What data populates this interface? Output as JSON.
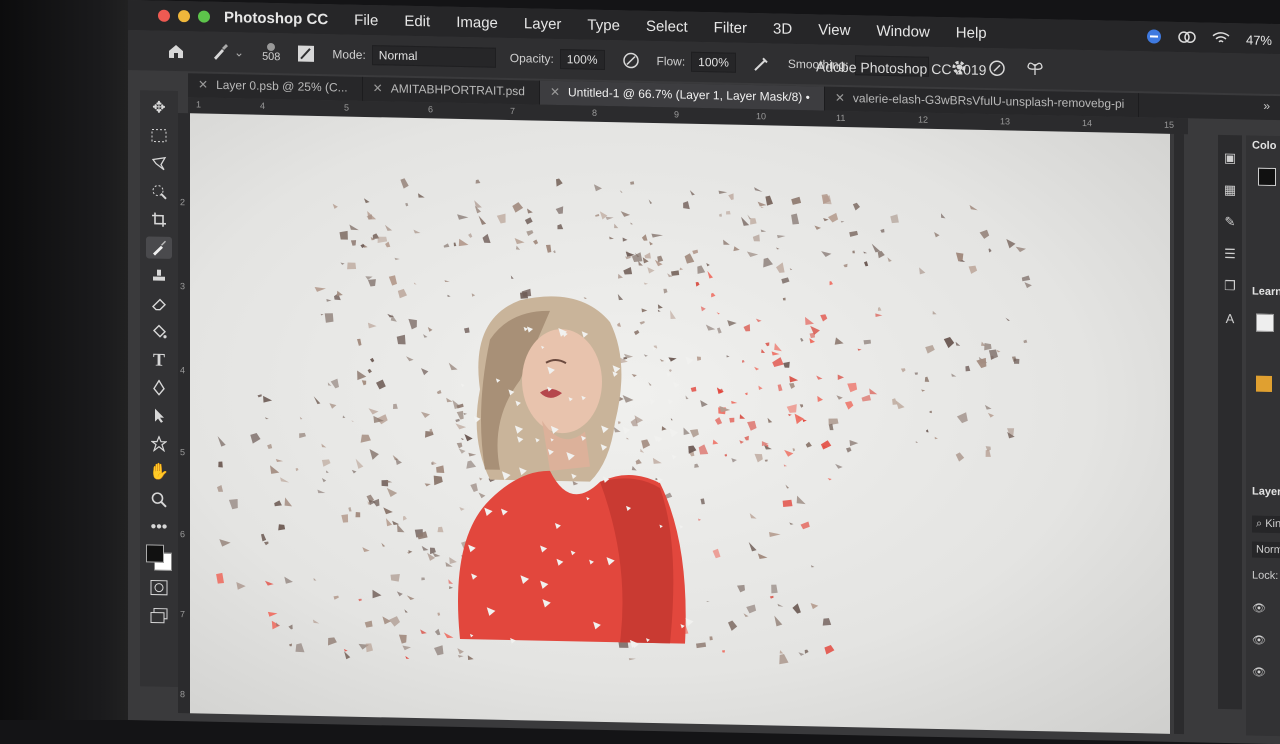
{
  "menubar": {
    "app_name": "Photoshop CC",
    "items": [
      "File",
      "Edit",
      "Image",
      "Layer",
      "Type",
      "Select",
      "Filter",
      "3D",
      "View",
      "Window",
      "Help"
    ],
    "battery": "47%"
  },
  "options": {
    "brush_size": "508",
    "mode_label": "Mode:",
    "mode_value": "Normal",
    "opacity_label": "Opacity:",
    "opacity_value": "100%",
    "flow_label": "Flow:",
    "flow_value": "100%",
    "smoothing_label": "Smoothing:",
    "app_title": "Adobe Photoshop CC 2019"
  },
  "tabs": [
    {
      "label": "Layer 0.psb @ 25% (C..."
    },
    {
      "label": "AMITABHPORTRAIT.psd"
    },
    {
      "label": "Untitled-1 @ 66.7% (Layer 1, Layer Mask/8) •"
    },
    {
      "label": "valerie-elash-G3wBRsVfulU-unsplash-removebg-pi"
    }
  ],
  "tabs_overflow": "»",
  "ruler": {
    "top": [
      "1",
      "4",
      "5",
      "6",
      "7",
      "8",
      "9",
      "10",
      "11",
      "12",
      "13",
      "14",
      "15"
    ],
    "left": [
      "2",
      "3",
      "4",
      "5",
      "6",
      "7",
      "8"
    ]
  },
  "panels": {
    "color": "Colo",
    "learn": "Learn",
    "layers": "Layers",
    "kind": "Kind",
    "blend": "Normal",
    "lock": "Lock:"
  },
  "colors": {
    "accent_red": "#e2473d",
    "canvas_bg": "#e9e9e7"
  }
}
